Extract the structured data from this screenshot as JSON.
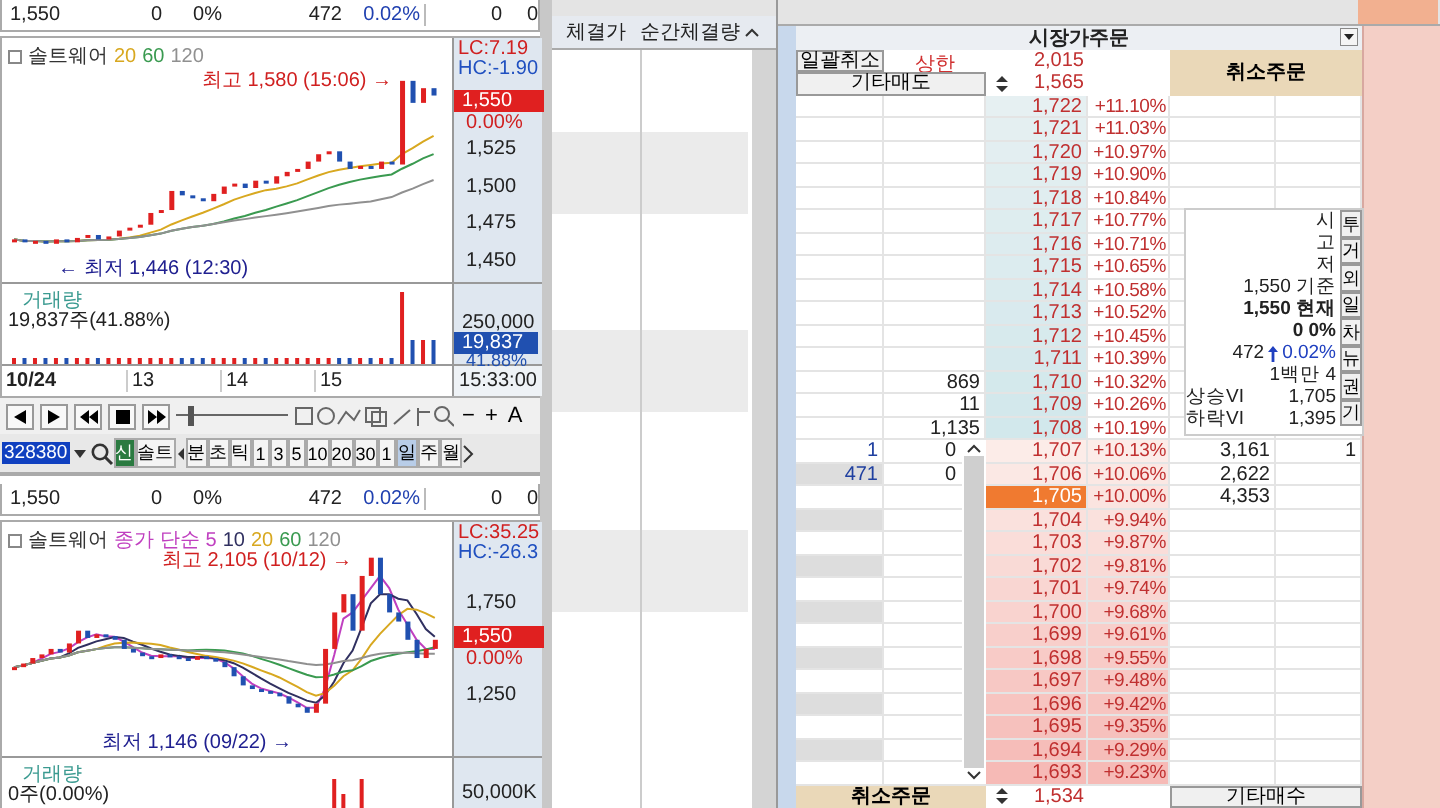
{
  "charts": [
    {
      "quote": [
        "1,550",
        "0",
        "0%",
        "472",
        "0.02%",
        "0",
        "0"
      ],
      "title": "솔트웨어",
      "legend": [
        {
          "label": "20",
          "color": "#d8a820"
        },
        {
          "label": "60",
          "color": "#3a9a50"
        },
        {
          "label": "120",
          "color": "#909090"
        }
      ],
      "high": "최고 1,580 (15:06) →",
      "low": "← 최저 1,446 (12:30)",
      "lc": "LC:7.19",
      "hc": "HC:-1.90",
      "price_tag": "1,550",
      "price_rate": "0.00%",
      "yticks": [
        "1,525",
        "1,500",
        "1,475",
        "1,450"
      ],
      "volume": {
        "title": "거래량",
        "value": "19,837주(41.88%)",
        "tick": "250,000",
        "tag": "19,837",
        "tag_rate": "41.88%"
      },
      "xlabels": [
        "10/24",
        "13",
        "14",
        "15"
      ],
      "time": "15:33:00"
    },
    {
      "quote": [
        "1,550",
        "0",
        "0%",
        "472",
        "0.02%",
        "0",
        "0"
      ],
      "title": "솔트웨어",
      "legend_prefix": "종가 단순",
      "legend": [
        {
          "label": "5",
          "color": "#c040c0"
        },
        {
          "label": "10",
          "color": "#303060"
        },
        {
          "label": "20",
          "color": "#d8a820"
        },
        {
          "label": "60",
          "color": "#3a9a50"
        },
        {
          "label": "120",
          "color": "#909090"
        }
      ],
      "high": "최고 2,105 (10/12) →",
      "low": "최저 1,146 (09/22) →",
      "lc": "LC:35.25",
      "hc": "HC:-26.3",
      "price_tag": "1,550",
      "price_rate": "0.00%",
      "yticks": [
        "1,750",
        "1,250"
      ],
      "volume": {
        "title": "거래량",
        "value": "0주(0.00%)",
        "tick": "50,000K"
      }
    }
  ],
  "toolbar": {
    "zoom_slider": {
      "level": 0.1
    },
    "tools": [
      "−",
      "+",
      "A"
    ],
    "code": "328380",
    "buttons": [
      {
        "label": "신",
        "selected": true
      },
      {
        "label": "솔트",
        "selected": false
      },
      {
        "label": "분",
        "selected": false
      },
      {
        "label": "초",
        "selected": false
      },
      {
        "label": "틱",
        "selected": false
      },
      {
        "label": "1",
        "selected": false
      },
      {
        "label": "3",
        "selected": false
      },
      {
        "label": "5",
        "selected": false
      },
      {
        "label": "10",
        "selected": false
      },
      {
        "label": "20",
        "selected": false
      },
      {
        "label": "30",
        "selected": false
      },
      {
        "label": "1",
        "selected": false
      },
      {
        "label": "일",
        "selected": true
      },
      {
        "label": "주",
        "selected": false
      },
      {
        "label": "월",
        "selected": false
      }
    ]
  },
  "trades": {
    "columns": [
      "체결가",
      "순간체결량"
    ]
  },
  "orderbook": {
    "title": "시장가주문",
    "cancel_all": "일괄취소",
    "upper_label": "상한",
    "upper_price": "2,015",
    "other_sell": "기타매도",
    "base_price": "1,565",
    "cancel_order": "취소주문",
    "asks": [
      {
        "price": "1,722",
        "rate": "+11.10%"
      },
      {
        "price": "1,721",
        "rate": "+11.03%"
      },
      {
        "price": "1,720",
        "rate": "+10.97%"
      },
      {
        "price": "1,719",
        "rate": "+10.90%"
      },
      {
        "price": "1,718",
        "rate": "+10.84%"
      },
      {
        "price": "1,717",
        "rate": "+10.77%"
      },
      {
        "price": "1,716",
        "rate": "+10.71%"
      },
      {
        "price": "1,715",
        "rate": "+10.65%"
      },
      {
        "price": "1,714",
        "rate": "+10.58%"
      },
      {
        "price": "1,713",
        "rate": "+10.52%"
      },
      {
        "price": "1,712",
        "rate": "+10.45%"
      },
      {
        "price": "1,711",
        "rate": "+10.39%"
      },
      {
        "qty": "869",
        "price": "1,710",
        "rate": "+10.32%"
      },
      {
        "qty": "11",
        "price": "1,709",
        "rate": "+10.26%"
      },
      {
        "qty": "1,135",
        "price": "1,708",
        "rate": "+10.19%"
      }
    ],
    "bids": [
      {
        "mine": "1",
        "mine_qty": "0",
        "price": "1,707",
        "rate": "+10.13%",
        "qty": "3,161",
        "extra": "1",
        "selected": false
      },
      {
        "mine": "471",
        "mine_qty": "0",
        "price": "1,706",
        "rate": "+10.06%",
        "qty": "2,622",
        "selected": false
      },
      {
        "price": "1,705",
        "rate": "+10.00%",
        "qty": "4,353",
        "selected": true
      },
      {
        "price": "1,704",
        "rate": "+9.94%",
        "selected": false
      },
      {
        "price": "1,703",
        "rate": "+9.87%",
        "selected": false
      },
      {
        "price": "1,702",
        "rate": "+9.81%",
        "selected": false
      },
      {
        "price": "1,701",
        "rate": "+9.74%",
        "selected": false
      },
      {
        "price": "1,700",
        "rate": "+9.68%",
        "selected": false
      },
      {
        "price": "1,699",
        "rate": "+9.61%",
        "selected": false
      },
      {
        "price": "1,698",
        "rate": "+9.55%",
        "selected": false
      },
      {
        "price": "1,697",
        "rate": "+9.48%",
        "selected": false
      },
      {
        "price": "1,696",
        "rate": "+9.42%",
        "selected": false
      },
      {
        "price": "1,695",
        "rate": "+9.35%",
        "selected": false
      },
      {
        "price": "1,694",
        "rate": "+9.29%",
        "selected": false
      },
      {
        "price": "1,693",
        "rate": "+9.23%",
        "selected": false
      }
    ],
    "info": [
      {
        "kind": "plain",
        "text": "시"
      },
      {
        "kind": "plain",
        "text": "고"
      },
      {
        "kind": "plain",
        "text": "저"
      },
      {
        "kind": "plain",
        "text": "1,550 기준"
      },
      {
        "kind": "current",
        "text": "1,550 현재"
      },
      {
        "kind": "current",
        "text": "0 0%"
      },
      {
        "kind": "change",
        "text": "472",
        "change": "0.02%"
      },
      {
        "kind": "plain",
        "text": "1백만 4"
      },
      {
        "kind": "vi",
        "label": "상승VI",
        "value": "1,705"
      },
      {
        "kind": "vi",
        "label": "하락VI",
        "value": "1,395"
      }
    ],
    "side_tabs": [
      "투",
      "거",
      "외",
      "일",
      "차",
      "뉴",
      "권",
      "기"
    ],
    "footer": {
      "cancel": "취소주문",
      "price": "1,534",
      "other_buy": "기타매수"
    }
  }
}
